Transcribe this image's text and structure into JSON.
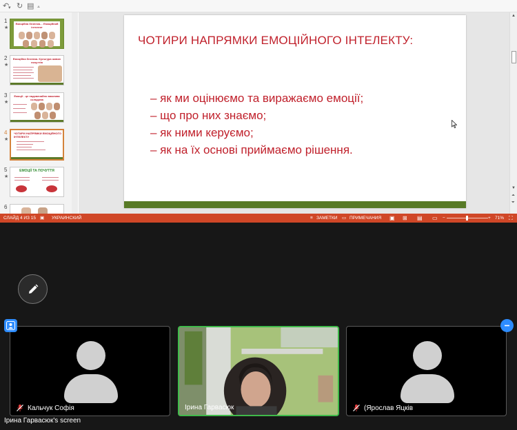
{
  "slide": {
    "title": "ЧОТИРИ НАПРЯМКИ  ЕМОЦІЙНОГО ІНТЕЛЕКТУ:",
    "bullets": [
      "– як ми оцінюємо та виражаємо емоції;",
      "– що про них знаємо;",
      "– як ними керуємо;",
      "– як на їх основі приймаємо рішення."
    ]
  },
  "thumbnails": [
    {
      "number": "1",
      "star": "★",
      "title": "Емоційна безпека… Емоційний інтелект"
    },
    {
      "number": "2",
      "star": "★",
      "title": "Емоційна безпека. Культура живих почуттів"
    },
    {
      "number": "3",
      "star": "★",
      "title": "Емоції - це надзвичайно важлива складова"
    },
    {
      "number": "4",
      "star": "★",
      "title": "ЧОТИРИ НАПРЯМКИ ЕМОЦІЙНОГО ІНТЕЛЕКТУ"
    },
    {
      "number": "5",
      "star": "★",
      "title": "ЕМОЦІЇ ТА ПОЧУТТЯ"
    },
    {
      "number": "6",
      "star": "",
      "title": ""
    }
  ],
  "status_bar": {
    "slide_counter": "СЛАЙД 4 ИЗ 15",
    "language": "УКРАИНСКИЙ",
    "notes_label": "ЗАМЕТКИ",
    "comments_label": "ПРИМЕЧАНИЯ",
    "zoom_minus": "−",
    "zoom_plus": "+",
    "zoom_value": "71%"
  },
  "participants": [
    {
      "name": "Кальчук Софія",
      "muted": true,
      "video": false
    },
    {
      "name": "Ірина Гарвасюк",
      "muted": false,
      "video": true
    },
    {
      "name": "(Ярослав Яцків",
      "muted": true,
      "video": false
    }
  ],
  "share_label": "Ірина Гарвасюк's screen",
  "icons": {
    "undo": "undo-icon",
    "redo": "redo-icon",
    "slideshow": "slideshow-icon",
    "pen": "pen-icon",
    "mic_muted": "mic-muted-icon"
  },
  "colors": {
    "accent_red": "#c0202b",
    "band_green": "#587a26",
    "status_orange": "#d04727",
    "active_speaker": "#3fba4a",
    "zoom_blue": "#2d8cff"
  }
}
